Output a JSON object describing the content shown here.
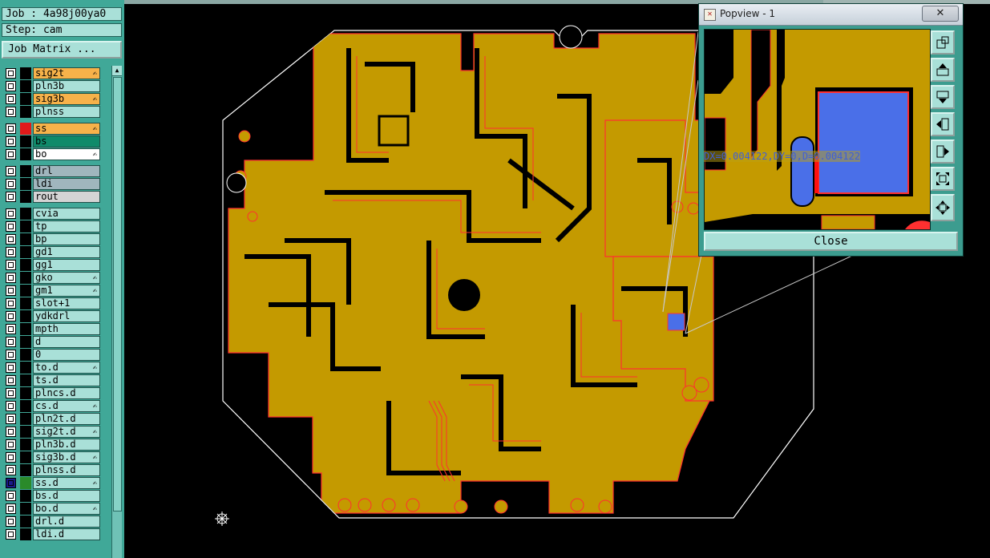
{
  "header": {
    "job": "Job : 4a98j00ya0",
    "step": "Step: cam",
    "job_matrix_label": "Job Matrix ..."
  },
  "layers": [
    {
      "name": "sig2t",
      "swatch": "#000000",
      "label_bg": "#f7b24a",
      "editable": true
    },
    {
      "name": "pln3b",
      "swatch": "#000000",
      "label_bg": "#a9e0d8",
      "editable": false
    },
    {
      "name": "sig3b",
      "swatch": "#000000",
      "label_bg": "#f7b24a",
      "editable": true
    },
    {
      "name": "plnss",
      "swatch": "#000000",
      "label_bg": "#a9e0d8",
      "editable": false
    },
    {
      "name": "ss",
      "swatch": "#e01a1a",
      "label_bg": "#f7b24a",
      "editable": true
    },
    {
      "name": "bs",
      "swatch": "#000000",
      "label_bg": "#0f8a6a",
      "editable": false
    },
    {
      "name": "bo",
      "swatch": "#000000",
      "label_bg": "#ffffff",
      "editable": true
    },
    {
      "name": "drl",
      "swatch": "#000000",
      "label_bg": "#a0b6bd",
      "editable": false
    },
    {
      "name": "ldi",
      "swatch": "#000000",
      "label_bg": "#a0b6bd",
      "editable": false
    },
    {
      "name": "rout",
      "swatch": "#000000",
      "label_bg": "#d4d4d4",
      "editable": false
    },
    {
      "name": "cvia",
      "swatch": "#000000",
      "label_bg": "#a9e0d8",
      "editable": false
    },
    {
      "name": "tp",
      "swatch": "#000000",
      "label_bg": "#a9e0d8",
      "editable": false
    },
    {
      "name": "bp",
      "swatch": "#000000",
      "label_bg": "#a9e0d8",
      "editable": false
    },
    {
      "name": "gd1",
      "swatch": "#000000",
      "label_bg": "#a9e0d8",
      "editable": false
    },
    {
      "name": "gg1",
      "swatch": "#000000",
      "label_bg": "#a9e0d8",
      "editable": false
    },
    {
      "name": "gko",
      "swatch": "#000000",
      "label_bg": "#a9e0d8",
      "editable": true
    },
    {
      "name": "gm1",
      "swatch": "#000000",
      "label_bg": "#a9e0d8",
      "editable": true
    },
    {
      "name": "slot+1",
      "swatch": "#000000",
      "label_bg": "#a9e0d8",
      "editable": false
    },
    {
      "name": "ydkdrl",
      "swatch": "#000000",
      "label_bg": "#a9e0d8",
      "editable": false
    },
    {
      "name": "mpth",
      "swatch": "#000000",
      "label_bg": "#a9e0d8",
      "editable": false
    },
    {
      "name": "d",
      "swatch": "#000000",
      "label_bg": "#a9e0d8",
      "editable": false
    },
    {
      "name": "0",
      "swatch": "#000000",
      "label_bg": "#a9e0d8",
      "editable": false
    },
    {
      "name": "to.d",
      "swatch": "#000000",
      "label_bg": "#a9e0d8",
      "editable": true
    },
    {
      "name": "ts.d",
      "swatch": "#000000",
      "label_bg": "#a9e0d8",
      "editable": false
    },
    {
      "name": "plncs.d",
      "swatch": "#000000",
      "label_bg": "#a9e0d8",
      "editable": false
    },
    {
      "name": "cs.d",
      "swatch": "#000000",
      "label_bg": "#a9e0d8",
      "editable": true
    },
    {
      "name": "pln2t.d",
      "swatch": "#000000",
      "label_bg": "#a9e0d8",
      "editable": false
    },
    {
      "name": "sig2t.d",
      "swatch": "#000000",
      "label_bg": "#a9e0d8",
      "editable": true
    },
    {
      "name": "pln3b.d",
      "swatch": "#000000",
      "label_bg": "#a9e0d8",
      "editable": false
    },
    {
      "name": "sig3b.d",
      "swatch": "#000000",
      "label_bg": "#a9e0d8",
      "editable": true
    },
    {
      "name": "plnss.d",
      "swatch": "#000000",
      "label_bg": "#a9e0d8",
      "editable": false
    },
    {
      "name": "ss.d",
      "swatch": "#2a8a2a",
      "label_bg": "#a9e0d8",
      "editable": true,
      "checkbox_bg": "#1a1a8a"
    },
    {
      "name": "bs.d",
      "swatch": "#000000",
      "label_bg": "#a9e0d8",
      "editable": false
    },
    {
      "name": "bo.d",
      "swatch": "#000000",
      "label_bg": "#a9e0d8",
      "editable": true
    },
    {
      "name": "drl.d",
      "swatch": "#000000",
      "label_bg": "#a9e0d8",
      "editable": false
    },
    {
      "name": "ldi.d",
      "swatch": "#000000",
      "label_bg": "#a9e0d8",
      "editable": false
    }
  ],
  "popview": {
    "title": "Popview - 1",
    "close_x": "✕",
    "measurement": "DX=0.004122,DY=0,D=0.004122",
    "close_label": "Close"
  },
  "colors": {
    "copper": "#c49a00",
    "trace_edge": "#ff3030",
    "highlight": "#4a6fe8",
    "panel": "#40a898",
    "label": "#a9e0d8"
  }
}
